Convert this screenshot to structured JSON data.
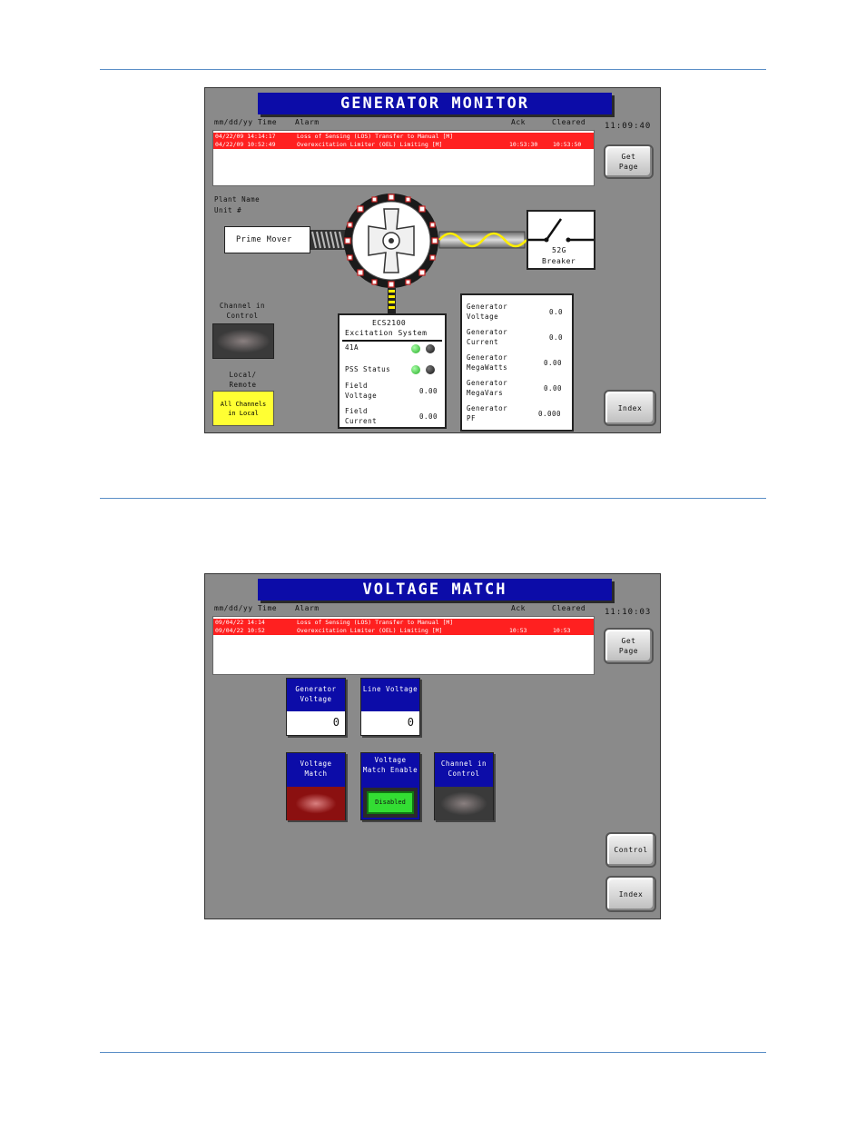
{
  "panel1": {
    "title": "GENERATOR MONITOR",
    "time": "11:09:40",
    "headers": {
      "date": "mm/dd/yy Time",
      "alarm": "Alarm",
      "ack": "Ack",
      "cleared": "Cleared"
    },
    "alarms": [
      {
        "datetime": "04/22/09 14:14:17",
        "text": "Loss of Sensing (LOS) Transfer to Manual [M]",
        "ack": "",
        "cleared": ""
      },
      {
        "datetime": "04/22/09 10:52:49",
        "text": "Overexcitation Limiter (OEL) Limiting [M]",
        "ack": "10:53:30",
        "cleared": "10:53:50"
      }
    ],
    "plant_name": "Plant Name",
    "unit": "Unit #",
    "prime_mover": "Prime Mover",
    "breaker_number": "52G",
    "breaker_label": "Breaker",
    "get_page": "Get Page",
    "index": "Index",
    "channel_in_control": "Channel in Control",
    "local_remote": "Local/ Remote",
    "all_channels": "All Channels in Local",
    "excitation": {
      "title1": "ECS2100",
      "title2": "Excitation System",
      "row_41a": "41A",
      "pss_status": "PSS Status",
      "field_voltage_label": "Field Voltage",
      "field_voltage_value": "0.00",
      "field_current_label": "Field Current",
      "field_current_value": "0.00"
    },
    "gen_values": [
      {
        "label": "Generator Voltage",
        "value": "0.0"
      },
      {
        "label": "Generator Current",
        "value": "0.0"
      },
      {
        "label": "Generator MegaWatts",
        "value": "0.00"
      },
      {
        "label": "Generator MegaVars",
        "value": "0.00"
      },
      {
        "label": "Generator PF",
        "value": "0.000"
      }
    ]
  },
  "panel2": {
    "title": "VOLTAGE MATCH",
    "time": "11:10:03",
    "headers": {
      "date": "mm/dd/yy Time",
      "alarm": "Alarm",
      "ack": "Ack",
      "cleared": "Cleared"
    },
    "alarms": [
      {
        "datetime": "09/04/22 14:14",
        "text": "Loss of Sensing (LOS) Transfer to Manual [M]",
        "ack": "",
        "cleared": ""
      },
      {
        "datetime": "09/04/22 10:52",
        "text": "Overexcitation Limiter (OEL) Limiting [M]",
        "ack": "10:53",
        "cleared": "10:53"
      }
    ],
    "generator_voltage_label": "Generator Voltage",
    "generator_voltage_value": "0",
    "line_voltage_label": "Line Voltage",
    "line_voltage_value": "0",
    "voltage_match_label": "Voltage Match",
    "voltage_match_enable_label": "Voltage Match Enable",
    "voltage_match_enable_state": "Disabled",
    "channel_in_control_label": "Channel in Control",
    "get_page": "Get Page",
    "control": "Control",
    "index": "Index"
  },
  "colors": {
    "panel_bg": "#8a8a8a",
    "title_bg": "#0c0ca8",
    "alarm_red": "#ff2020",
    "yellow": "#ffff33",
    "green": "#33dd33",
    "dark_red": "#8b1010"
  }
}
